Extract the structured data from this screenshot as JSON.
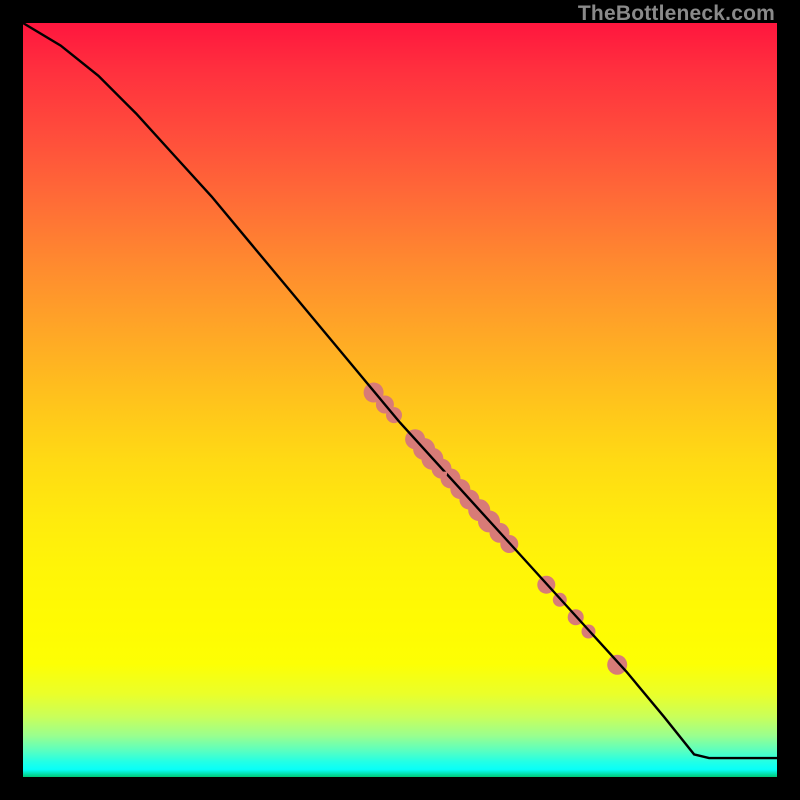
{
  "watermark": "TheBottleneck.com",
  "chart_data": {
    "type": "line",
    "title": "",
    "xlabel": "",
    "ylabel": "",
    "xlim": [
      0,
      100
    ],
    "ylim": [
      0,
      100
    ],
    "grid": false,
    "line": {
      "color": "#000000",
      "points": [
        {
          "x": 0,
          "y": 100
        },
        {
          "x": 5,
          "y": 97
        },
        {
          "x": 10,
          "y": 93
        },
        {
          "x": 15,
          "y": 88
        },
        {
          "x": 20,
          "y": 82.5
        },
        {
          "x": 25,
          "y": 77
        },
        {
          "x": 30,
          "y": 71
        },
        {
          "x": 35,
          "y": 65
        },
        {
          "x": 40,
          "y": 59
        },
        {
          "x": 45,
          "y": 53
        },
        {
          "x": 50,
          "y": 47
        },
        {
          "x": 55,
          "y": 41.5
        },
        {
          "x": 60,
          "y": 36
        },
        {
          "x": 65,
          "y": 30.5
        },
        {
          "x": 70,
          "y": 25
        },
        {
          "x": 75,
          "y": 19.5
        },
        {
          "x": 80,
          "y": 14
        },
        {
          "x": 85,
          "y": 8
        },
        {
          "x": 89,
          "y": 3
        },
        {
          "x": 91,
          "y": 2.5
        },
        {
          "x": 100,
          "y": 2.5
        }
      ]
    },
    "markers": {
      "color": "#d87b77",
      "points": [
        {
          "x": 46.5,
          "y": 51.0,
          "r": 10
        },
        {
          "x": 48.0,
          "y": 49.4,
          "r": 9
        },
        {
          "x": 49.2,
          "y": 48.0,
          "r": 8
        },
        {
          "x": 52.0,
          "y": 44.8,
          "r": 10
        },
        {
          "x": 53.2,
          "y": 43.5,
          "r": 11
        },
        {
          "x": 54.3,
          "y": 42.2,
          "r": 11
        },
        {
          "x": 55.5,
          "y": 40.9,
          "r": 10
        },
        {
          "x": 56.7,
          "y": 39.6,
          "r": 10
        },
        {
          "x": 58.0,
          "y": 38.2,
          "r": 10
        },
        {
          "x": 59.2,
          "y": 36.8,
          "r": 10
        },
        {
          "x": 60.5,
          "y": 35.4,
          "r": 11
        },
        {
          "x": 61.8,
          "y": 33.9,
          "r": 11
        },
        {
          "x": 63.2,
          "y": 32.4,
          "r": 10
        },
        {
          "x": 64.5,
          "y": 30.9,
          "r": 9
        },
        {
          "x": 69.4,
          "y": 25.5,
          "r": 9
        },
        {
          "x": 71.2,
          "y": 23.5,
          "r": 7
        },
        {
          "x": 73.3,
          "y": 21.2,
          "r": 8
        },
        {
          "x": 75.0,
          "y": 19.3,
          "r": 7
        },
        {
          "x": 78.8,
          "y": 14.9,
          "r": 10
        }
      ]
    }
  }
}
